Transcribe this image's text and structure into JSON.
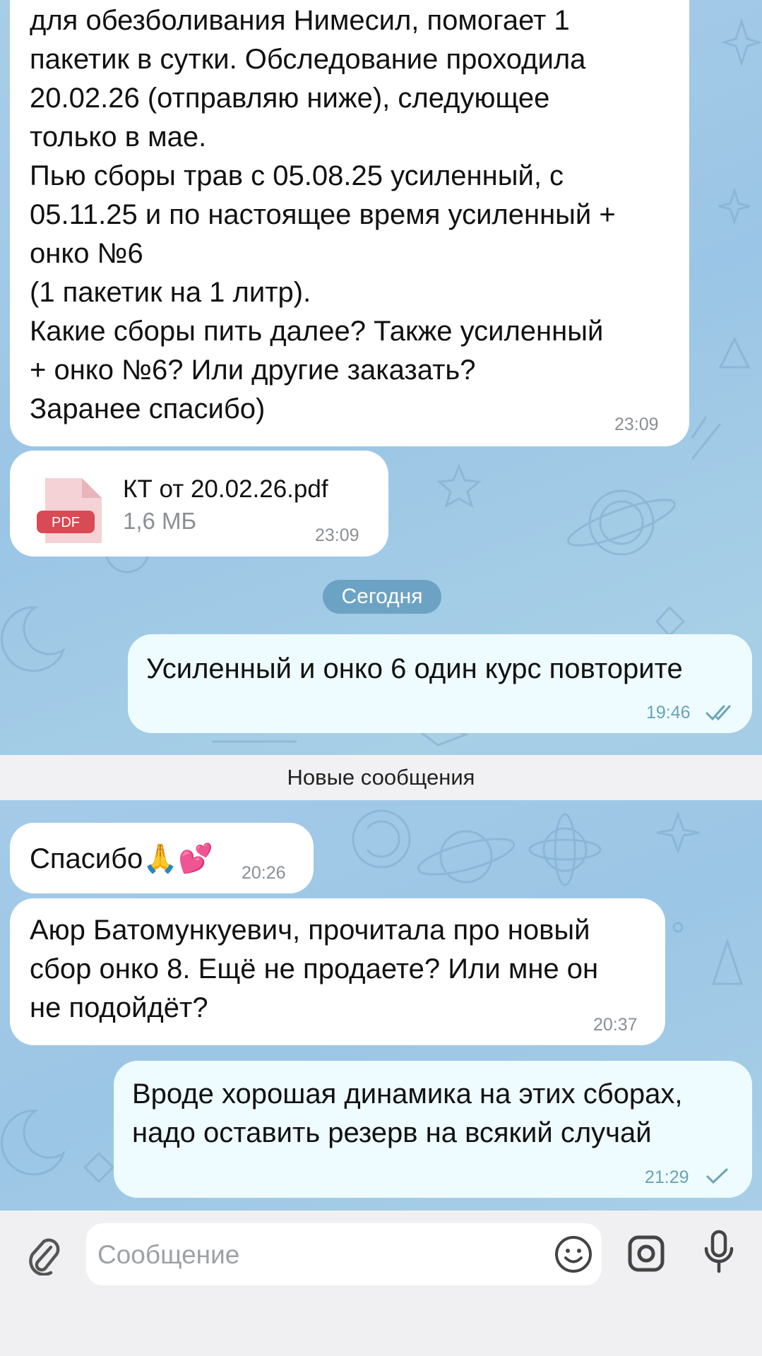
{
  "messages": {
    "m1": {
      "text": "для обезболивания Нимесил, помогает 1\nпакетик в сутки. Обследование проходила\n20.02.26 (отправляю ниже), следующее\nтолько в мае.\nПью сборы трав с 05.08.25 усиленный, с\n05.11.25 и по настоящее время усиленный +\nонко №6\n(1 пакетик на 1 литр).\nКакие сборы пить далее? Также усиленный\n+ онко №6? Или другие заказать?\nЗаранее спасибо)",
      "time": "23:09"
    },
    "file": {
      "icon_label": "PDF",
      "name": "КТ от 20.02.26.pdf",
      "size": "1,6 МБ",
      "time": "23:09"
    },
    "date_separator": "Сегодня",
    "m2": {
      "text": "Усиленный и онко 6 один курс повторите",
      "time": "19:46",
      "status": "read"
    },
    "new_messages_label": "Новые сообщения",
    "m3": {
      "text": "Спасибо🙏💕",
      "time": "20:26"
    },
    "m4": {
      "text": "Аюр Батомункуевич, прочитала про новый\nсбор онко 8. Ещё не продаете? Или мне он\nне подойдёт?",
      "time": "20:37"
    },
    "m5": {
      "text": "Вроде хорошая динамика на этих сборах,\nнадо оставить резерв на всякий случай",
      "time": "21:29",
      "status": "sent"
    }
  },
  "composer": {
    "placeholder": "Сообщение",
    "icons": [
      "paperclip-icon",
      "emoji-icon",
      "camera-icon",
      "microphone-icon"
    ]
  },
  "colors": {
    "chat_background": "#a9cde8",
    "incoming_bubble": "#ffffff",
    "outgoing_bubble": "#eefbff",
    "pdf_badge": "#d84a54",
    "check_color": "#6aa3b4"
  }
}
